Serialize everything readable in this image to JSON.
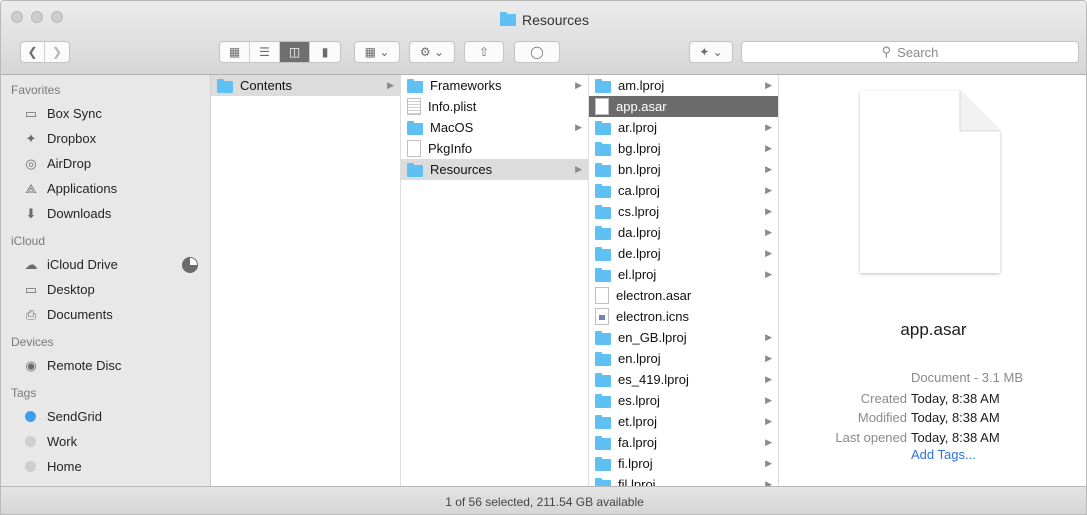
{
  "window": {
    "title": "Resources"
  },
  "toolbar": {
    "search_placeholder": "Search",
    "view_icons": [
      "icon-view-icon",
      "list-view-icon",
      "column-view-icon",
      "cover-flow-view-icon"
    ]
  },
  "sidebar": {
    "favorites_label": "Favorites",
    "favorites": [
      {
        "label": "Box Sync",
        "icon": "folder-icon"
      },
      {
        "label": "Dropbox",
        "icon": "dropbox-icon"
      },
      {
        "label": "AirDrop",
        "icon": "airdrop-icon"
      },
      {
        "label": "Applications",
        "icon": "applications-icon"
      },
      {
        "label": "Downloads",
        "icon": "downloads-icon"
      }
    ],
    "icloud_label": "iCloud",
    "icloud": [
      {
        "label": "iCloud Drive",
        "icon": "cloud-icon"
      },
      {
        "label": "Desktop",
        "icon": "desktop-icon"
      },
      {
        "label": "Documents",
        "icon": "documents-icon"
      }
    ],
    "devices_label": "Devices",
    "devices": [
      {
        "label": "Remote Disc",
        "icon": "disc-icon"
      }
    ],
    "tags_label": "Tags",
    "tags": [
      {
        "label": "SendGrid",
        "color": "#3b9ff0"
      },
      {
        "label": "Work",
        "color": "#cfcfcf"
      },
      {
        "label": "Home",
        "color": "#cfcfcf"
      }
    ]
  },
  "columns": [
    [
      {
        "name": "Contents",
        "kind": "folder",
        "chevron": true,
        "selected": "gray"
      }
    ],
    [
      {
        "name": "Frameworks",
        "kind": "folder",
        "chevron": true
      },
      {
        "name": "Info.plist",
        "kind": "plist",
        "chevron": false
      },
      {
        "name": "MacOS",
        "kind": "folder",
        "chevron": true
      },
      {
        "name": "PkgInfo",
        "kind": "file",
        "chevron": false
      },
      {
        "name": "Resources",
        "kind": "folder",
        "chevron": true,
        "selected": "gray"
      }
    ],
    [
      {
        "name": "am.lproj",
        "kind": "folder",
        "chevron": true
      },
      {
        "name": "app.asar",
        "kind": "file",
        "chevron": false,
        "selected": "dark"
      },
      {
        "name": "ar.lproj",
        "kind": "folder",
        "chevron": true
      },
      {
        "name": "bg.lproj",
        "kind": "folder",
        "chevron": true
      },
      {
        "name": "bn.lproj",
        "kind": "folder",
        "chevron": true
      },
      {
        "name": "ca.lproj",
        "kind": "folder",
        "chevron": true
      },
      {
        "name": "cs.lproj",
        "kind": "folder",
        "chevron": true
      },
      {
        "name": "da.lproj",
        "kind": "folder",
        "chevron": true
      },
      {
        "name": "de.lproj",
        "kind": "folder",
        "chevron": true
      },
      {
        "name": "el.lproj",
        "kind": "folder",
        "chevron": true
      },
      {
        "name": "electron.asar",
        "kind": "file",
        "chevron": false
      },
      {
        "name": "electron.icns",
        "kind": "icns",
        "chevron": false
      },
      {
        "name": "en_GB.lproj",
        "kind": "folder",
        "chevron": true
      },
      {
        "name": "en.lproj",
        "kind": "folder",
        "chevron": true
      },
      {
        "name": "es_419.lproj",
        "kind": "folder",
        "chevron": true
      },
      {
        "name": "es.lproj",
        "kind": "folder",
        "chevron": true
      },
      {
        "name": "et.lproj",
        "kind": "folder",
        "chevron": true
      },
      {
        "name": "fa.lproj",
        "kind": "folder",
        "chevron": true
      },
      {
        "name": "fi.lproj",
        "kind": "folder",
        "chevron": true
      },
      {
        "name": "fil.lproj",
        "kind": "folder",
        "chevron": true
      }
    ]
  ],
  "preview": {
    "name": "app.asar",
    "kind": "Document - 3.1 MB",
    "created_label": "Created",
    "created_value": "Today, 8:38 AM",
    "modified_label": "Modified",
    "modified_value": "Today, 8:38 AM",
    "opened_label": "Last opened",
    "opened_value": "Today, 8:38 AM",
    "add_tags": "Add Tags..."
  },
  "status": {
    "text": "1 of 56 selected, 211.54 GB available"
  }
}
